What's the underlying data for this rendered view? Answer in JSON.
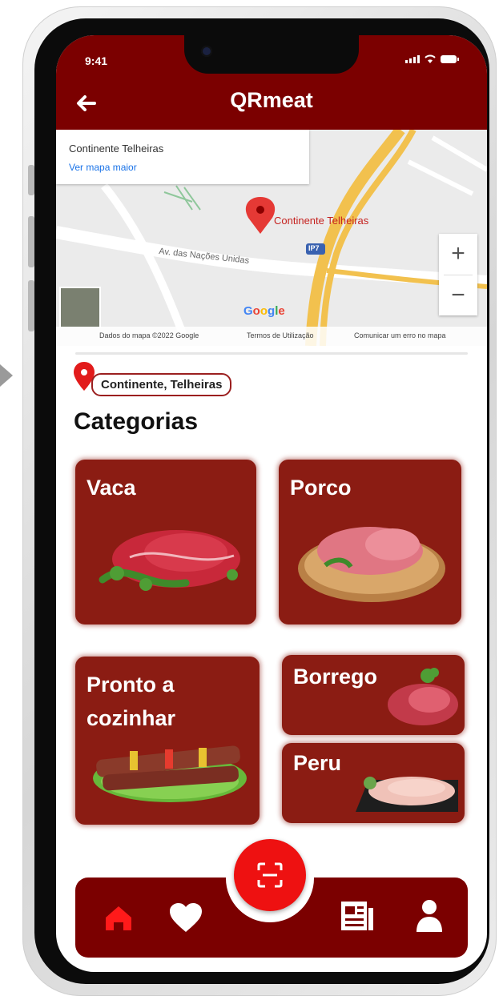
{
  "status_bar": {
    "time": "9:41"
  },
  "app_bar": {
    "title": "QRmeat",
    "back_icon": "arrow-left-icon"
  },
  "map": {
    "place_name": "Continente Telheiras",
    "link_text": "Ver mapa maior",
    "pin_label": "Continente Telheiras",
    "street_label": "Av. das Nações Unidas",
    "road_shield": "IP7",
    "provider": "Google",
    "zoom_in": "+",
    "zoom_out": "−",
    "footer": {
      "data": "Dados do mapa ©2022 Google",
      "terms": "Termos de Utilização",
      "report": "Comunicar um erro no mapa"
    }
  },
  "location": {
    "label": "Continente, Telheiras",
    "icon": "map-pin-icon"
  },
  "categories": {
    "title": "Categorias",
    "items": [
      {
        "label": "Vaca"
      },
      {
        "label": "Porco"
      },
      {
        "label": "Pronto a cozinhar"
      },
      {
        "label": "Borrego"
      },
      {
        "label": "Peru"
      }
    ]
  },
  "bottom_nav": {
    "items": [
      "home-icon",
      "heart-icon",
      "qr-scan-icon",
      "news-icon",
      "user-icon"
    ],
    "active": "home-icon"
  },
  "colors": {
    "brand": "#7b0000",
    "card": "#8b1c13",
    "fab": "#ee1111",
    "active_icon": "#ff1a1a"
  }
}
